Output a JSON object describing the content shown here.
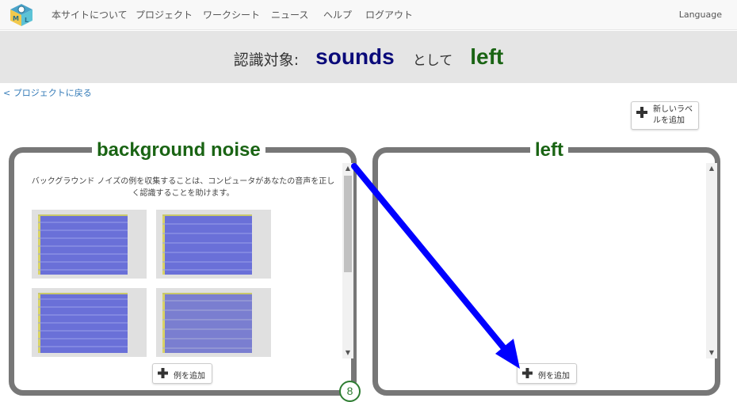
{
  "nav": {
    "items": [
      "本サイトについて",
      "プロジェクト",
      "ワークシート",
      "ニュース",
      "ヘルプ",
      "ログアウト"
    ],
    "language": "Language"
  },
  "header": {
    "prefix": "認識対象:",
    "project": "sounds",
    "as_text": "として",
    "label": "left"
  },
  "back_link": "< プロジェクトに戻る",
  "new_label_button": {
    "line1": "新しいラベ",
    "line2": "ルを追加"
  },
  "buckets": [
    {
      "title": "background noise",
      "hint": "バックグラウンド ノイズの例を収集することは、コンピュータがあなたの音声を正しく認識することを助けます。",
      "example_count": "8",
      "add_button": "例を追加"
    },
    {
      "title": "left",
      "add_button": "例を追加"
    }
  ],
  "colors": {
    "project_name": "#0b0b7a",
    "label_green": "#1a6414",
    "arrow_blue": "#0000ff",
    "bucket_border": "#777777",
    "spectrogram": "#6a70d8"
  },
  "icons": [
    "logo-icon",
    "plus-icon",
    "scroll-up-icon",
    "scroll-down-icon",
    "arrow-annotation"
  ]
}
